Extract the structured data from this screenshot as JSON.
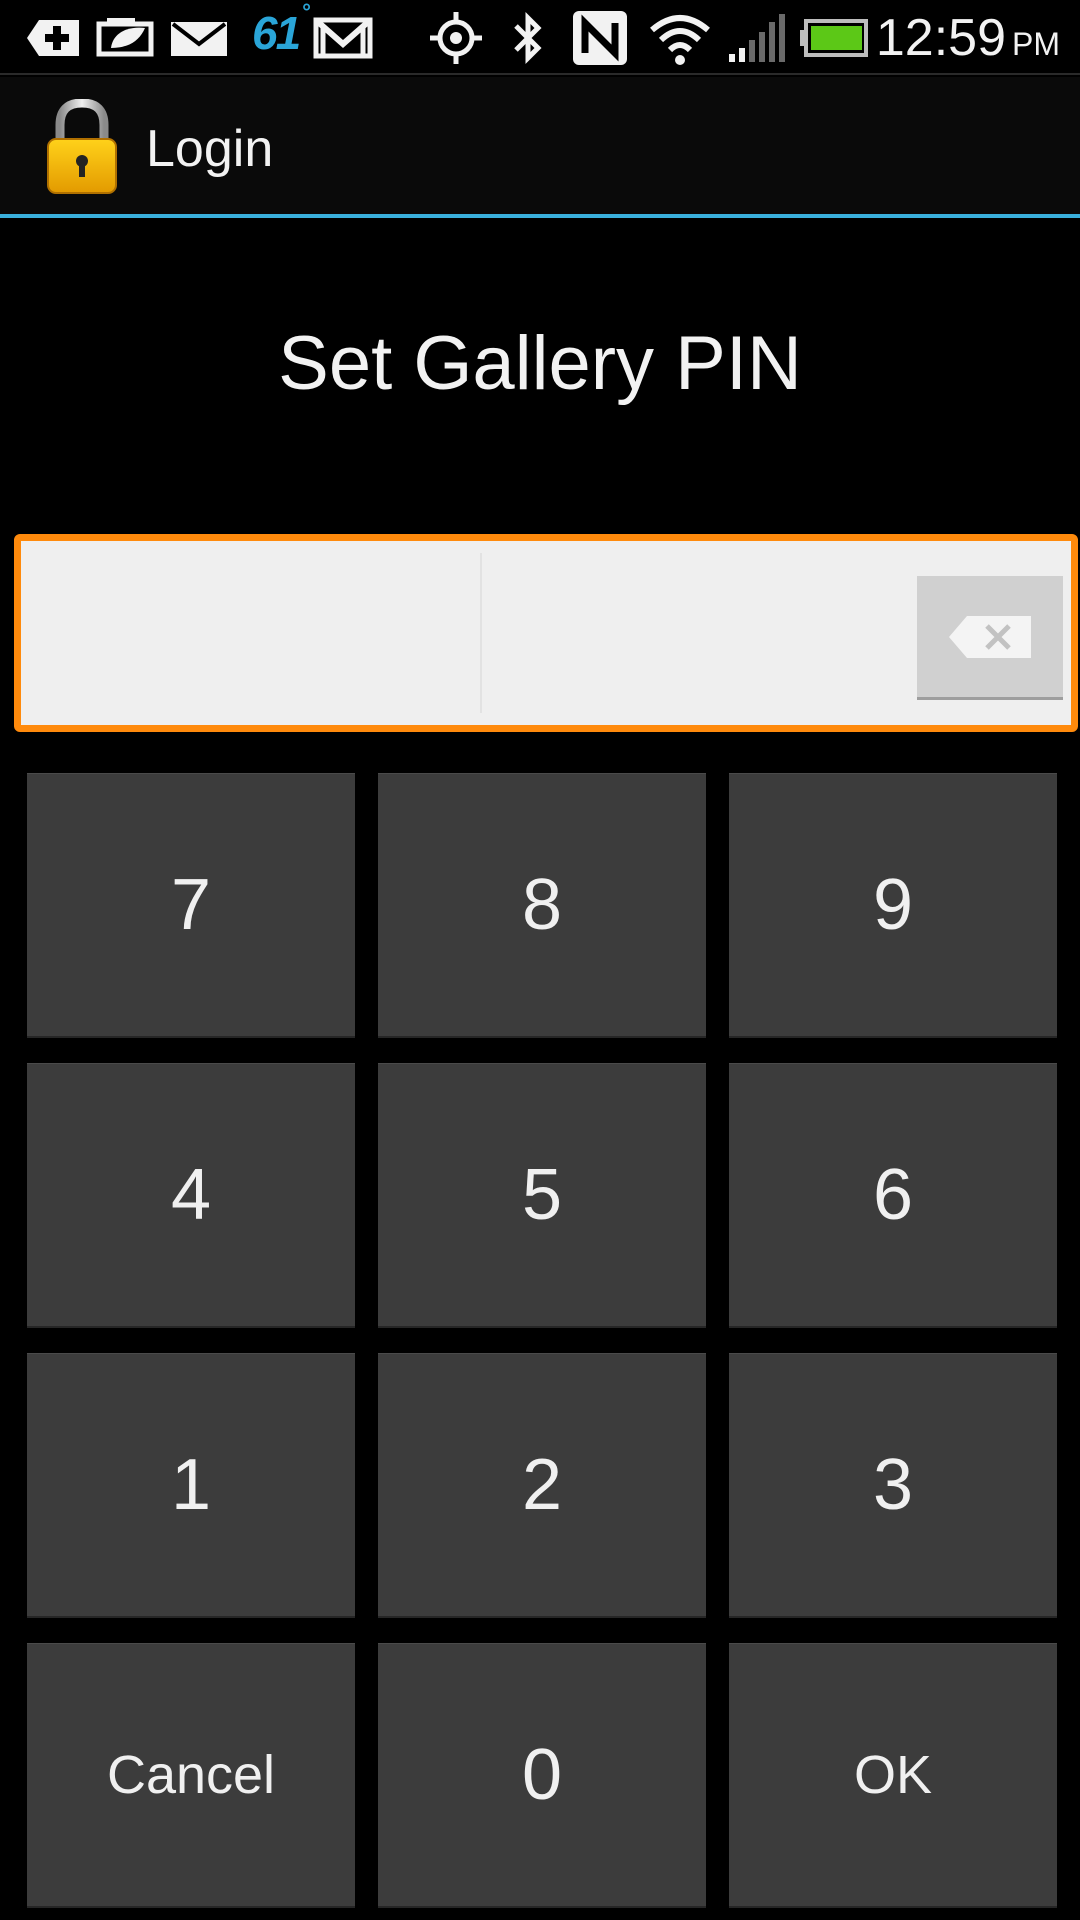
{
  "status_bar": {
    "icons": [
      "add-notification-icon",
      "photo-icon",
      "email-icon",
      "gmail-icon",
      "gps-icon",
      "bluetooth-icon",
      "nfc-icon",
      "wifi-icon",
      "signal-icon",
      "battery-icon"
    ],
    "temperature": "61",
    "temperature_unit": "°",
    "time": "12:59",
    "ampm": "PM",
    "accent_color": "#2aa5d8",
    "battery_color": "#5cc817"
  },
  "action_bar": {
    "title": "Login",
    "icon": "lock-icon",
    "divider_color": "#3ab0dc"
  },
  "heading": "Set Gallery PIN",
  "pin_field": {
    "value": "",
    "border_color": "#ff8a0c",
    "backspace_icon": "backspace-icon"
  },
  "keypad": {
    "keys": [
      {
        "label": "7"
      },
      {
        "label": "8"
      },
      {
        "label": "9"
      },
      {
        "label": "4"
      },
      {
        "label": "5"
      },
      {
        "label": "6"
      },
      {
        "label": "1"
      },
      {
        "label": "2"
      },
      {
        "label": "3"
      },
      {
        "label": "Cancel"
      },
      {
        "label": "0"
      },
      {
        "label": "OK"
      }
    ]
  }
}
